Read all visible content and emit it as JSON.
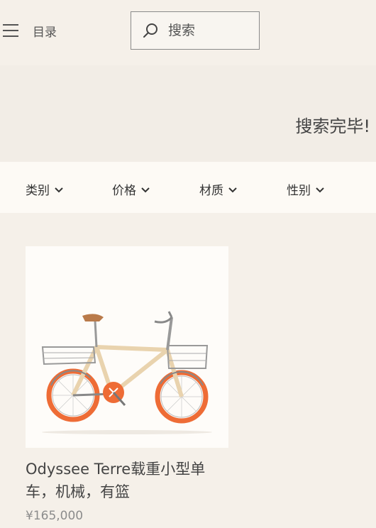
{
  "header": {
    "menu_label": "目录",
    "search_placeholder": "搜索"
  },
  "result": {
    "message": "搜索完毕!"
  },
  "filters": [
    {
      "label": "类别"
    },
    {
      "label": "价格"
    },
    {
      "label": "材质"
    },
    {
      "label": "性别"
    }
  ],
  "products": [
    {
      "name": "Odyssee Terre载重小型单车，机械，有篮",
      "price": "¥165,000"
    }
  ],
  "colors": {
    "background": "#f5f0e9",
    "filter_bar": "#fdfaf5",
    "tire_orange": "#ee6c36"
  },
  "icons": {
    "menu": "hamburger-icon",
    "search": "search-icon",
    "dropdown": "chevron-down-icon"
  }
}
